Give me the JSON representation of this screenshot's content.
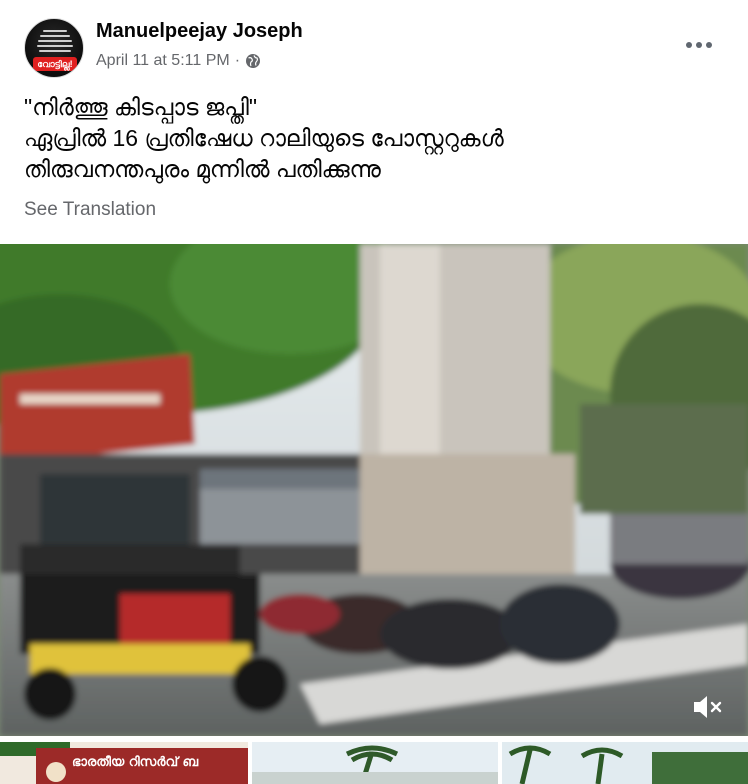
{
  "post": {
    "author": "Manuelpeejay Joseph",
    "timestamp": "April 11 at 5:11 PM",
    "separator": "·",
    "privacy_icon": "globe-icon",
    "avatar_badge_text": "വോട്ടില്ല!",
    "text_lines": [
      "\"നിർത്തൂ കിടപ്പാട ജപ്തി\"",
      "ഏപ്രിൽ 16 പ്രതിഷേധ റാലിയുടെ പോസ്റ്ററുകൾ",
      "തിരുവനന്തപുരം മുന്നിൽ പതിക്കുന്നു"
    ],
    "see_translation": "See Translation"
  },
  "media": {
    "video_state": "muted",
    "mute_icon": "speaker-muted-icon",
    "thumbnail_sign_text": "ഭാരതീയ റിസർവ് ബ"
  },
  "colors": {
    "secondary_text": "#65676b",
    "primary_text": "#050505",
    "badge_red": "#e02020"
  }
}
